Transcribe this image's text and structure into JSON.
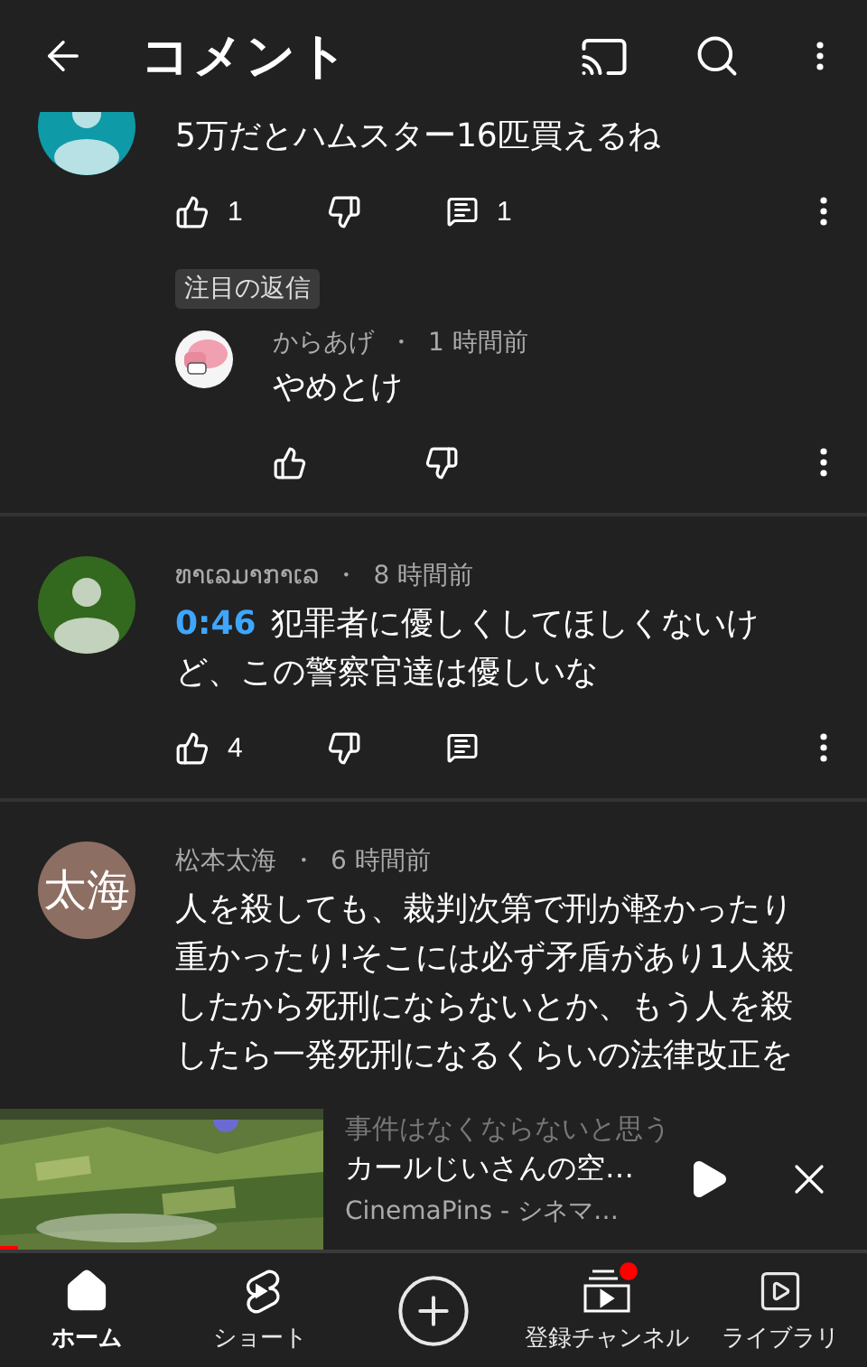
{
  "header": {
    "title": "コメント"
  },
  "comments": [
    {
      "avatar": {
        "kind": "plain",
        "color": "#0e9aa7"
      },
      "text": "5万だとハムスター16匹買えるね",
      "likes": "1",
      "replies": "1",
      "pinned_reply": {
        "badge": "注目の返信",
        "author": "からあげ",
        "separator": "・",
        "time": "1 時間前",
        "text": "やめとけ"
      }
    },
    {
      "avatar": {
        "kind": "plain",
        "color": "#33691e"
      },
      "author": "ທາເລມາກາເລ",
      "separator": "・",
      "time": "8 時間前",
      "timestamp_link": "0:46",
      "text": "犯罪者に優しくしてほしくないけど、この警察官達は優しいな",
      "likes": "4"
    },
    {
      "avatar": {
        "kind": "initials",
        "color": "#8d6e63",
        "initials": "太海"
      },
      "author": "松本太海",
      "separator": "・",
      "time": "6 時間前",
      "text": "人を殺しても、裁判次第で刑が軽かったり重かったり!そこには必ず矛盾があり1人殺したから死刑にならないとか、もう人を殺したら一発死刑になるくらいの法律改正を"
    }
  ],
  "mini_player": {
    "behind_text": "事件はなくならないと思う",
    "title": "カールじいさんの空…",
    "channel": "CinemaPins - シネマ…",
    "level": 0.02
  },
  "nav": [
    {
      "kind": "home",
      "label": "ホーム",
      "selected": true
    },
    {
      "kind": "shorts",
      "label": "ショート",
      "selected": false
    },
    {
      "kind": "create",
      "selected": false
    },
    {
      "kind": "subscriptions",
      "label": "登録チャンネル",
      "selected": false,
      "dot": true
    },
    {
      "kind": "library",
      "label": "ライブラリ",
      "selected": false
    }
  ]
}
